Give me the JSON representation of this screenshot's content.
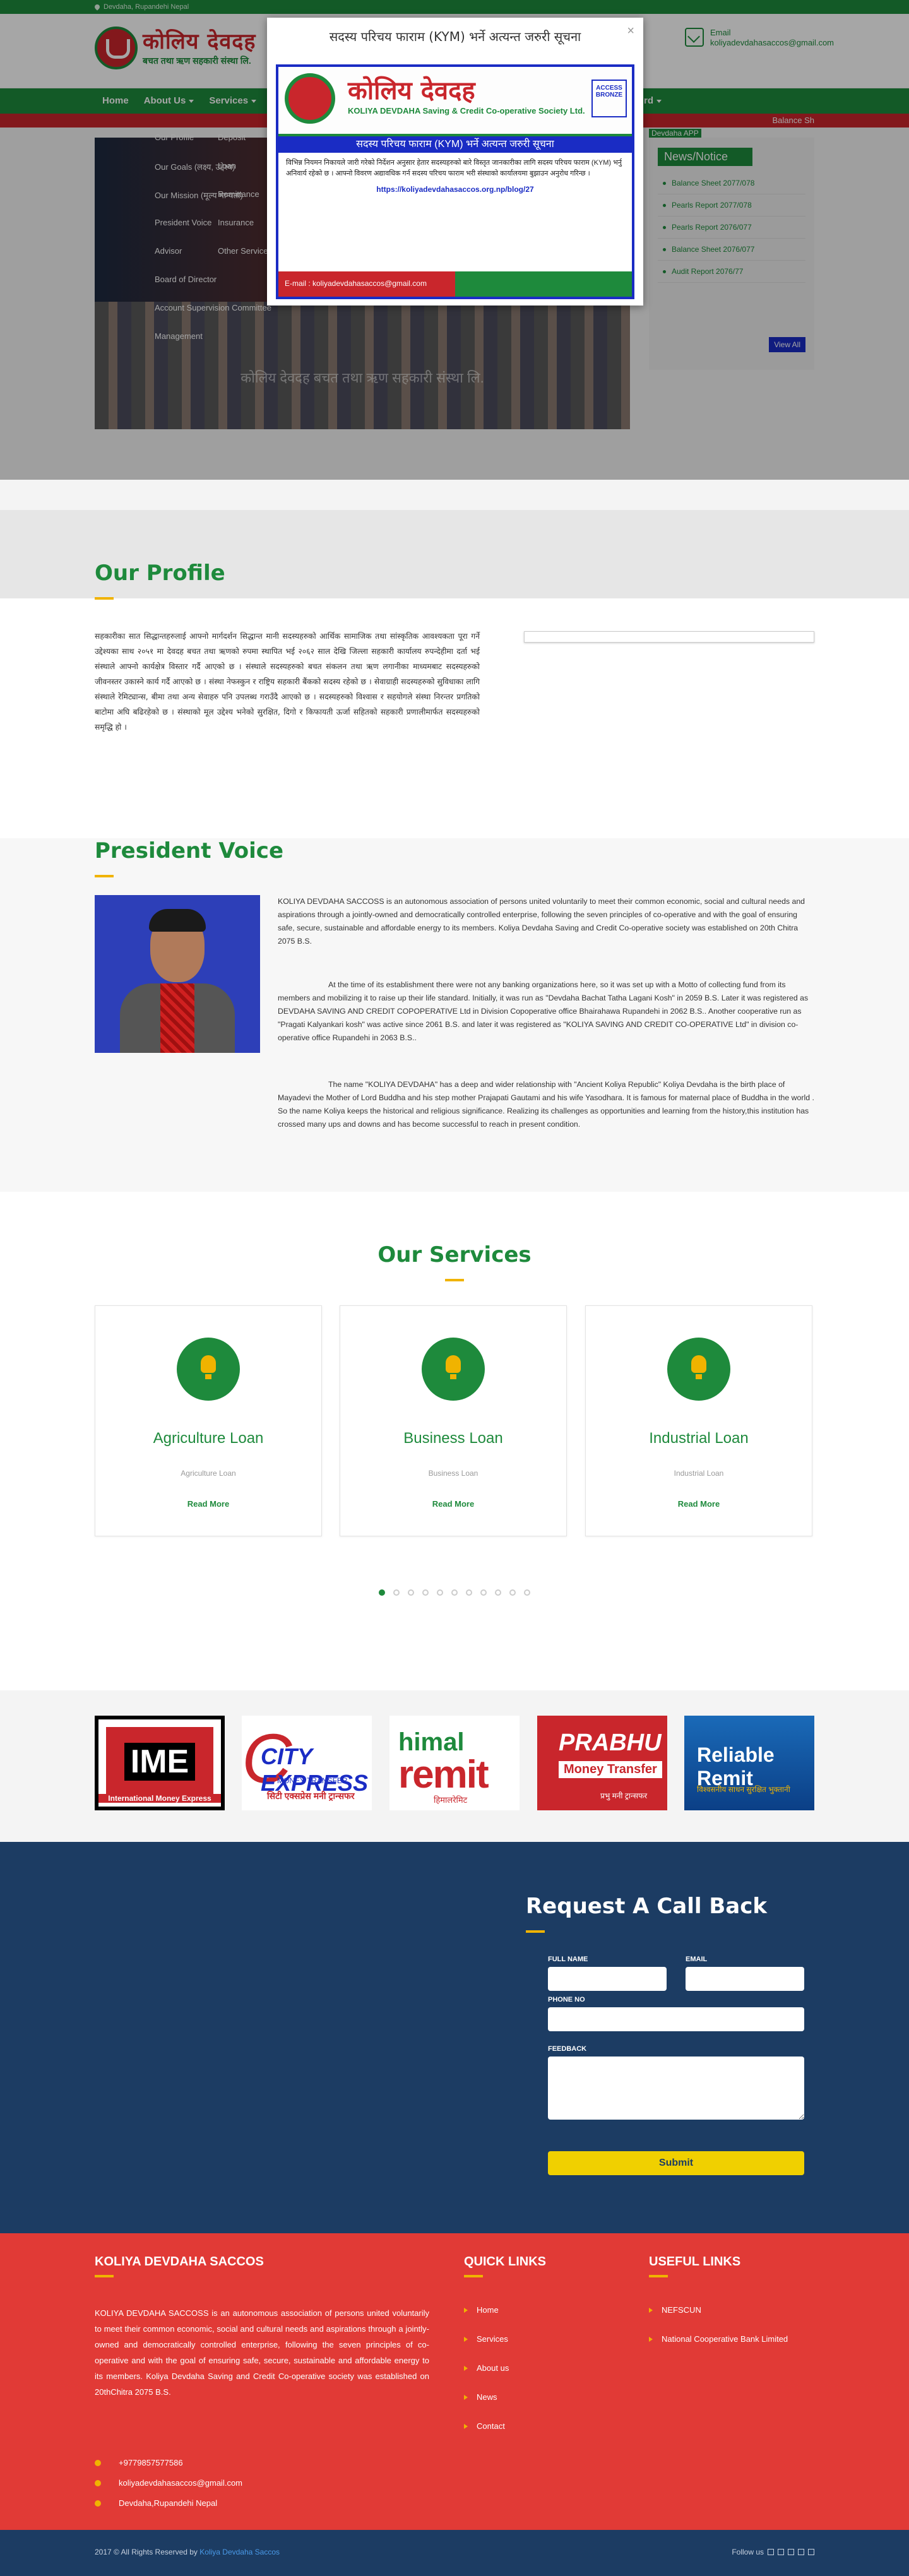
{
  "topbar": {
    "location": "Devdaha, Rupandehi Nepal"
  },
  "header": {
    "logo_title": "कोलिय देवदह",
    "logo_subtitle": "बचत तथा ऋण सहकारी संस्था लि.",
    "logo_english": "KOLIYA DEVDAHA Saving & Credit Co-operative Society Ltd.",
    "email_label": "Email",
    "email_value": "koliyadevdahasaccos@gmail.com"
  },
  "nav": {
    "items": [
      {
        "label": "Home",
        "caret": false
      },
      {
        "label": "About Us",
        "caret": true
      },
      {
        "label": "Services",
        "caret": true
      }
    ],
    "right_item": "rd",
    "ticker": "Balance Sh"
  },
  "dropdown": {
    "col1": [
      "Our Profile",
      "Our Goals (लक्ष्य, उद्देश्य)",
      "Our Mission (मूल्य मान्यता)",
      "President Voice",
      "Advisor",
      "Board of Director",
      "Account Supervision Committee",
      "Management"
    ],
    "col2": [
      "Deposit",
      "Loan",
      "Remittance",
      "Insurance",
      "Other Services"
    ]
  },
  "slider": {
    "caption": "कोलिय देवदह बचत तथा ऋण सहकारी संस्था लि."
  },
  "news": {
    "app_label": "Devdaha APP",
    "heading": "News/Notice",
    "items": [
      "Balance Sheet 2077/078",
      "Pearls Report 2077/078",
      "Pearls Report 2076/077",
      "Balance Sheet 2076/077",
      "Audit Report 2076/77"
    ],
    "view_all": "View All"
  },
  "modal": {
    "title": "सदस्य परिचय फाराम (KYM) भर्ने अत्यन्त जरुरी सूचना",
    "close": "×",
    "notice_name": "कोलिय देवदह",
    "notice_sub": "KOLIYA DEVDAHA Saving & Credit Co-operative Society Ltd.",
    "access_badge": "ACCESS BRONZE",
    "banner": "सदस्य परिचय फाराम (KYM) भर्ने अत्यन्त जरुरी सूचना",
    "body": "विभिन्न नियमन निकायले जारी गरेको निर्देशन अनुसार हेतार सदस्यहरुको बारे विस्तृत जानकारीका लागि सदस्य परिचय फाराम (KYM) भर्नु अनिवार्य रहेको छ । आफ्नो विवरण अद्यावधिक गर्न सदस्य परिचय फाराम भरी संस्थाको कार्यालयमा बुझाउन अनुरोध गरिन्छ ।",
    "link": "https://koliyadevdahasaccos.org.np/blog/27",
    "footer_email": "E-mail : koliyadevdahasaccos@gmail.com"
  },
  "profile": {
    "title": "Our Profile",
    "text": "सहकारीका सात सिद्धान्तहरुलाई आफ्नो मार्गदर्शन सिद्धान्त मानी सदस्यहरुको आर्थिक सामाजिक तथा सांस्कृतिक आवश्यकता पूरा गर्ने उद्देश्यका साथ २०५१ मा देवदह बचत तथा ऋणको रुपमा स्थापित भई २०६२ साल देखि जिल्ला सहकारी कार्यालय रुपन्देहीमा दर्ता भई संस्थाले आफ्नो कार्यक्षेत्र विस्तार गर्दै आएको छ । संस्थाले सदस्यहरुको बचत संकलन तथा ऋण लगानीका माध्यमबाट सदस्यहरुको जीवनस्तर उकास्ने कार्य गर्दै आएको छ । संस्था नेफस्कुन र राष्ट्रिय सहकारी बैंकको सदस्य रहेको छ । सेवाग्राही सदस्यहरुको सुविधाका लागि संस्थाले रेमिट्यान्स, बीमा तथा अन्य सेवाहरु पनि उपलब्ध गराउँदै आएको छ । सदस्यहरुको विश्वास र सहयोगले संस्था निरन्तर प्रगतिको बाटोमा अघि बढिरहेको छ । संस्थाको मूल उद्देश्य भनेको सुरक्षित, दिगो र किफायती ऊर्जा सहितको सहकारी प्रणालीमार्फत सदस्यहरुको समृद्धि हो ।"
  },
  "president": {
    "title": "President Voice",
    "p1": "KOLIYA DEVDAHA SACCOSS is an autonomous association of persons united voluntarily to meet their common economic, social and cultural needs and aspirations through a jointly-owned and democratically controlled enterprise, following the seven principles of co-operative and with the goal of ensuring safe, secure, sustainable and affordable energy to its members. Koliya Devdaha Saving and Credit Co-operative society was established on 20th Chitra 2075 B.S.",
    "p2": "At the time of its establishment  there were not any banking organizations here, so it was set up with a Motto  of collecting fund from its members and  mobilizing it to raise up their life standard. Initially, it was run as \"Devdaha Bachat Tatha Lagani Kosh\" in 2059 B.S. Later it was registered as DEVDAHA SAVING AND CREDIT COPOPERATIVE Ltd in Division Copoperative office Bhairahawa Rupandehi in 2062 B.S.. Another cooperative  run as \"Pragati Kalyankari kosh\" was active since 2061 B.S. and later it was registered as \"KOLIYA SAVING AND CREDIT CO-OPERATIVE Ltd\" in division co-operative office Rupandehi in 2063 B.S..",
    "p3": "The name \"KOLIYA DEVDAHA\" has a deep and wider relationship with \"Ancient Koliya Republic\" Koliya Devdaha is the birth place of Mayadevi the Mother of Lord Buddha and his step mother Prajapati Gautami and his wife Yasodhara. It is famous for maternal place of Buddha in the world . So the name Koliya keeps the historical  and religious significance. Realizing  its challenges as opportunities and learning from the history,this institution has crossed many ups and downs and has become successful to reach in present condition."
  },
  "services": {
    "title": "Our Services",
    "cards": [
      {
        "title": "Agriculture Loan",
        "sub": "Agriculture Loan",
        "more": "Read More"
      },
      {
        "title": "Business Loan",
        "sub": "Business Loan",
        "more": "Read More"
      },
      {
        "title": "Industrial Loan",
        "sub": "Industrial Loan",
        "more": "Read More"
      }
    ],
    "dot_count": 11,
    "active_dot": 0
  },
  "partners": {
    "ime": {
      "name": "IME",
      "tag": "International Money Express"
    },
    "city": {
      "name": "CITY EXPRESS",
      "sub": "MONEY TRANSFER",
      "dev": "सिटी एक्सप्रेस मनी ट्रान्सफर"
    },
    "himal": {
      "t1": "himal",
      "t2": "remit",
      "t3": "हिमालरेमिट"
    },
    "prabhu": {
      "t1": "PRABHU",
      "t2": "Money Transfer",
      "t3": "प्रभु मनी ट्रान्सफर"
    },
    "reliable": {
      "t1": "Reliable Remit",
      "t2": "विश्वसनीय साधन सुरक्षित भुक्तानी"
    }
  },
  "callback": {
    "title": "Request A Call Back",
    "full_name_label": "FULL NAME",
    "email_label": "EMAIL",
    "phone_label": "PHONE NO",
    "feedback_label": "FEEDBACK",
    "submit": "Submit"
  },
  "footer": {
    "col1_title": "KOLIYA DEVDAHA SACCOS",
    "about": "KOLIYA DEVDAHA SACCOSS is an autonomous association of persons united voluntarily to meet their common economic, social and cultural needs and aspirations through a jointly-owned and democratically controlled enterprise, following the seven principles of co-operative and with the goal of ensuring safe, secure, sustainable and affordable energy to its members. Koliya Devdaha Saving and Credit Co-operative society was established on 20thChitra 2075 B.S.",
    "phone": "+9779857577586",
    "email": "koliyadevdahasaccos@gmail.com",
    "address": "Devdaha,Rupandehi Nepal",
    "col2_title": "QUICK LINKS",
    "quick_links": [
      "Home",
      "Services",
      "About us",
      "News",
      "Contact"
    ],
    "col3_title": "USEFUL LINKS",
    "useful_links": [
      "NEFSCUN",
      "National Cooperative Bank Limited"
    ]
  },
  "copyright": {
    "text": "2017 © All Rights Reserved by ",
    "brand": "Koliya Devdaha Saccos",
    "follow": "Follow us"
  }
}
